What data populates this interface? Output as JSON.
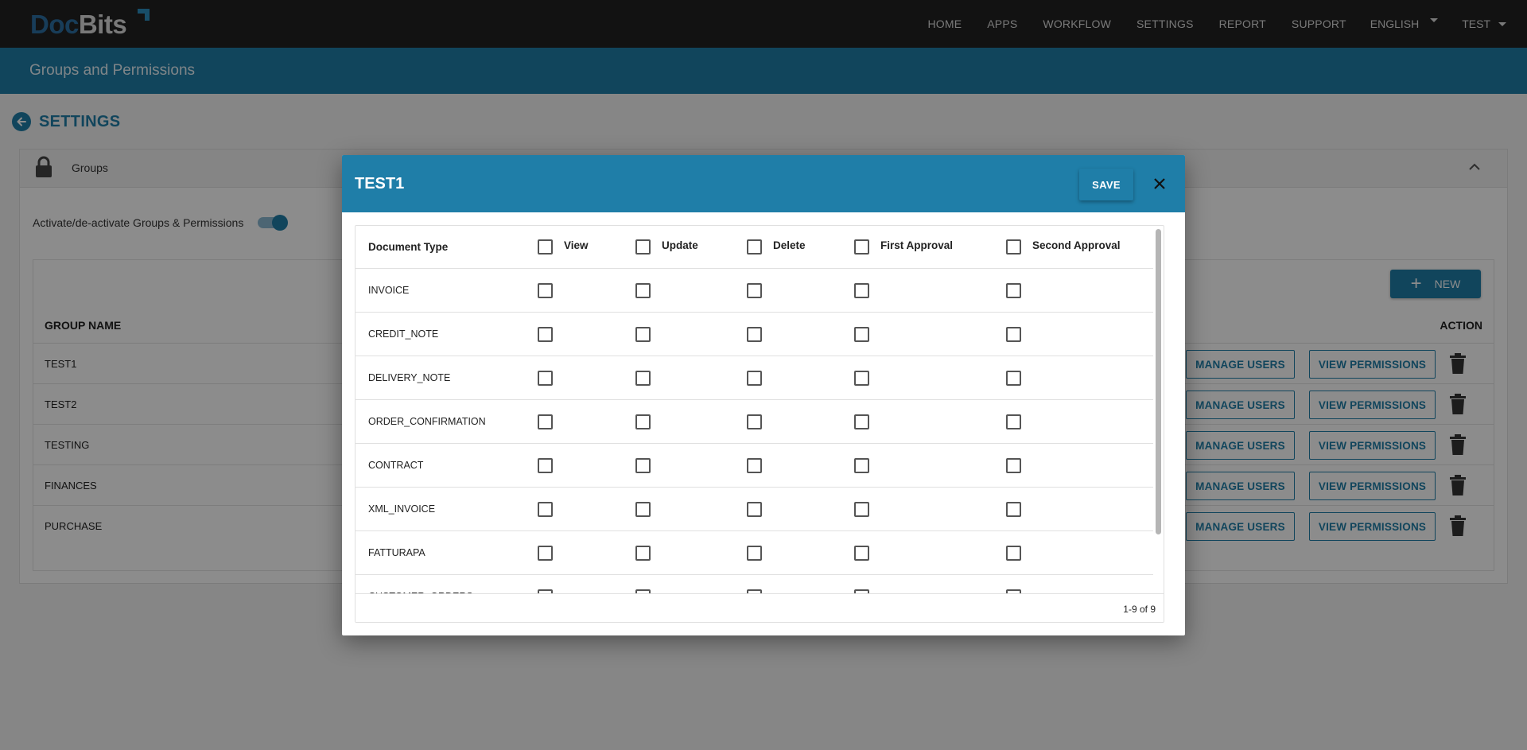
{
  "app": {
    "logo_doc": "Doc",
    "logo_bits": "Bits",
    "brand_color": "#1f7ea8"
  },
  "nav": {
    "items": [
      "HOME",
      "APPS",
      "WORKFLOW",
      "SETTINGS",
      "REPORT",
      "SUPPORT"
    ],
    "language": "ENGLISH",
    "user": "TEST"
  },
  "page": {
    "title": "Groups and Permissions",
    "back_label": "SETTINGS"
  },
  "groups_panel": {
    "title": "Groups",
    "toggle_label": "Activate/de-activate Groups & Permissions",
    "toggle_on": true,
    "new_button": "NEW",
    "col_group_name": "GROUP NAME",
    "col_action": "ACTION",
    "manage_users_label": "MANAGE USERS",
    "view_permissions_label": "VIEW PERMISSIONS",
    "groups": [
      "TEST1",
      "TEST2",
      "TESTING",
      "FINANCES",
      "PURCHASE"
    ]
  },
  "modal": {
    "title": "TEST1",
    "save_label": "SAVE",
    "columns": {
      "document_type": "Document Type",
      "view": "View",
      "update": "Update",
      "delete": "Delete",
      "first_approval": "First Approval",
      "second_approval": "Second Approval"
    },
    "document_types": [
      "INVOICE",
      "CREDIT_NOTE",
      "DELIVERY_NOTE",
      "ORDER_CONFIRMATION",
      "CONTRACT",
      "XML_INVOICE",
      "FATTURAPA",
      "CUSTOMER_ORDERS"
    ],
    "pagination": "1-9 of 9"
  }
}
